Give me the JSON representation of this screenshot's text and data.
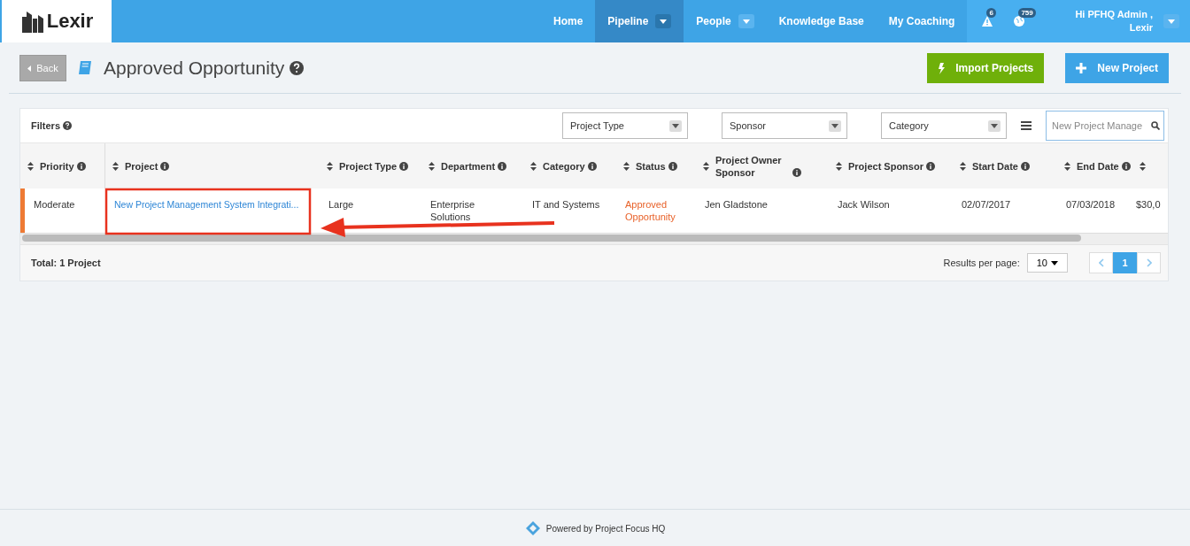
{
  "brand": {
    "name": "Lexir"
  },
  "nav": [
    {
      "label": "Home",
      "selected": false,
      "dropdown": false
    },
    {
      "label": "Pipeline",
      "selected": true,
      "dropdown": true
    },
    {
      "label": "People",
      "selected": false,
      "dropdown": true
    },
    {
      "label": "Knowledge Base",
      "selected": false,
      "dropdown": false
    },
    {
      "label": "My Coaching",
      "selected": false,
      "dropdown": false
    }
  ],
  "notifications": [
    {
      "kind": "alert",
      "count": "6"
    },
    {
      "kind": "globe",
      "count": "759"
    }
  ],
  "user": {
    "greeting": "Hi PFHQ Admin ,",
    "org": "Lexir"
  },
  "page": {
    "back": "Back",
    "title": "Approved Opportunity",
    "actions": [
      {
        "kind": "import",
        "label": "Import Projects"
      },
      {
        "kind": "new",
        "label": "New Project"
      }
    ]
  },
  "filters": {
    "label": "Filters",
    "dropdowns": [
      "Project Type",
      "Sponsor",
      "Category"
    ],
    "search": "New Project Manage"
  },
  "table": {
    "columns": [
      {
        "label": "Priority",
        "kind": "text"
      },
      {
        "label": "Project",
        "kind": "link"
      },
      {
        "label": "Project Type",
        "kind": "text"
      },
      {
        "label": "Department",
        "kind": "text"
      },
      {
        "label": "Category",
        "kind": "text"
      },
      {
        "label": "Status",
        "kind": "status"
      },
      {
        "label": "Project Owner Sponsor",
        "kind": "text"
      },
      {
        "label": "Project Sponsor",
        "kind": "text"
      },
      {
        "label": "Start Date",
        "kind": "text"
      },
      {
        "label": "End Date",
        "kind": "text"
      },
      {
        "kind": "text"
      }
    ],
    "rows": [
      {
        "color": "#ee7a34",
        "cells": [
          "Moderate",
          "New Project Management System Integrati...",
          "Large",
          "Enterprise Solutions",
          "IT and Systems",
          "Approved Opportunity",
          "Jen Gladstone",
          "Jack Wilson",
          "02/07/2017",
          "07/03/2018",
          "$30,0"
        ]
      }
    ]
  },
  "footer_bar": {
    "total": "Total: 1 Project",
    "per_page_label": "Results per page:",
    "per_page": "10",
    "pages": [
      {
        "label": "1",
        "selected": true
      }
    ]
  },
  "footer": {
    "text": "Powered by Project Focus HQ"
  }
}
